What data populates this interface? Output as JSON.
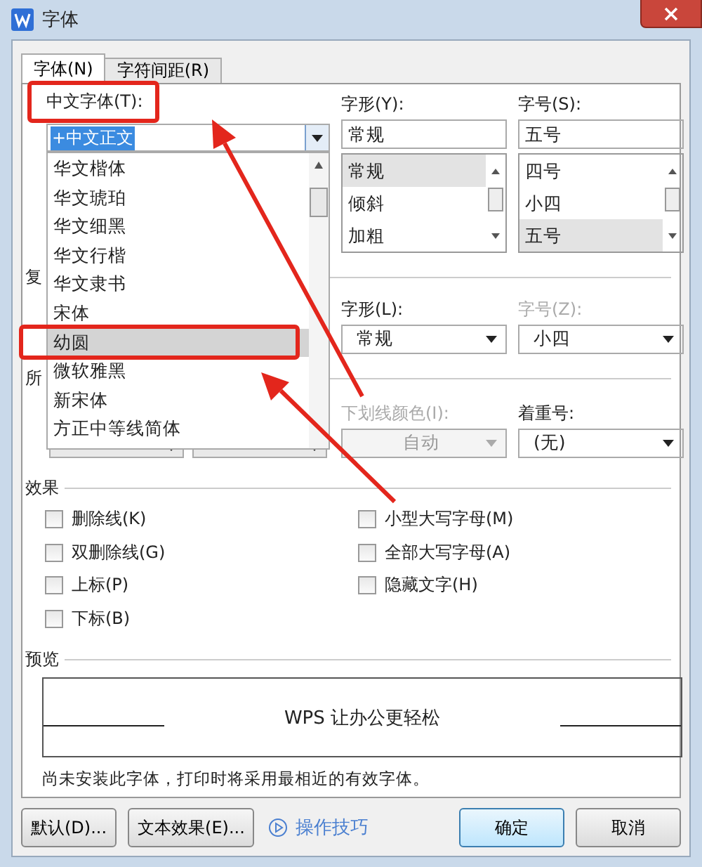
{
  "window": {
    "title": "字体"
  },
  "tabs": [
    {
      "label": "字体(N)",
      "selected": true
    },
    {
      "label": "字符间距(R)",
      "selected": false
    }
  ],
  "chinese_font": {
    "label": "中文字体(T):",
    "value": "+中文正文",
    "dropdown_items": [
      {
        "label": "华文楷体",
        "selected": false
      },
      {
        "label": "华文琥珀",
        "selected": false
      },
      {
        "label": "华文细黑",
        "selected": false
      },
      {
        "label": "华文行楷",
        "selected": false
      },
      {
        "label": "华文隶书",
        "selected": false
      },
      {
        "label": "宋体",
        "selected": false
      },
      {
        "label": "幼圆",
        "selected": true
      },
      {
        "label": "微软雅黑",
        "selected": false
      },
      {
        "label": "新宋体",
        "selected": false
      },
      {
        "label": "方正中等线简体",
        "selected": false
      }
    ]
  },
  "section_headings": [
    "复",
    "所"
  ],
  "style": {
    "label": "字形(Y):",
    "value": "常规",
    "options": [
      {
        "label": "常规",
        "selected": true
      },
      {
        "label": "倾斜",
        "selected": false
      },
      {
        "label": "加粗",
        "selected": false
      }
    ]
  },
  "size": {
    "label": "字号(S):",
    "value": "五号",
    "options": [
      {
        "label": "四号",
        "selected": false
      },
      {
        "label": "小四",
        "selected": false
      },
      {
        "label": "五号",
        "selected": true
      }
    ]
  },
  "complex_style": {
    "label": "字形(L):",
    "value": "常规",
    "disabled": false
  },
  "complex_size": {
    "label": "字号(Z):",
    "value": "小四",
    "disabled": true
  },
  "underline_color": {
    "label": "下划线颜色(I):",
    "value": "自动",
    "disabled": true
  },
  "emphasis": {
    "label": "着重号:",
    "value": "(无)",
    "disabled": false
  },
  "effects": {
    "title": "效果",
    "columns": [
      [
        {
          "label": "删除线(K)",
          "checked": false
        },
        {
          "label": "双删除线(G)",
          "checked": false
        },
        {
          "label": "上标(P)",
          "checked": false
        },
        {
          "label": "下标(B)",
          "checked": false
        }
      ],
      [
        {
          "label": "小型大写字母(M)",
          "checked": false
        },
        {
          "label": "全部大写字母(A)",
          "checked": false
        },
        {
          "label": "隐藏文字(H)",
          "checked": false
        }
      ]
    ]
  },
  "preview": {
    "title": "预览",
    "sample": "WPS 让办公更轻松"
  },
  "note": "尚未安装此字体，打印时将采用最相近的有效字体。",
  "buttons": [
    {
      "label": "默认(D)...",
      "kind": "button"
    },
    {
      "label": "文本效果(E)...",
      "kind": "button"
    },
    {
      "label": "操作技巧",
      "kind": "link"
    },
    {
      "label": "确定",
      "kind": "default"
    },
    {
      "label": "取消",
      "kind": "button"
    }
  ]
}
